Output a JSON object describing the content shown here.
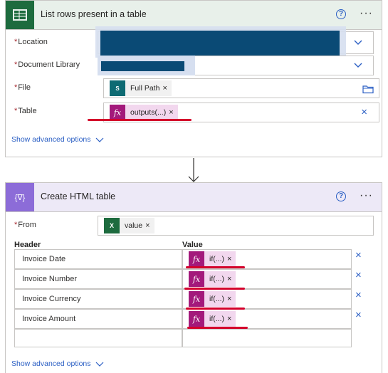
{
  "list_rows": {
    "title": "List rows present in a table",
    "fields": {
      "location_label": "Location",
      "library_label": "Document Library",
      "file_label": "File",
      "table_label": "Table"
    },
    "file_token": "Full Path",
    "table_token": "outputs(...)",
    "show_advanced": "Show advanced options"
  },
  "html_table": {
    "title": "Create HTML table",
    "from_label": "From",
    "from_token": "value",
    "header_col": "Header",
    "value_col": "Value",
    "rows": [
      {
        "header": "Invoice Date",
        "value": "if(...)"
      },
      {
        "header": "Invoice Number",
        "value": "if(...)"
      },
      {
        "header": "Invoice Currency",
        "value": "if(...)"
      },
      {
        "header": "Invoice Amount",
        "value": "if(...)"
      }
    ],
    "show_advanced": "Show advanced options"
  },
  "icons": {
    "help": "?",
    "more": "···",
    "close": "×",
    "fx": "fx",
    "sharepoint": "S",
    "excel": "X",
    "html_icon": "{∇}"
  },
  "colors": {
    "excel_header": "#e8f0ea",
    "html_header": "#ede9f7",
    "accent": "#2b5fc4",
    "redacted": "#0a4a75",
    "annotation": "#d4002b"
  }
}
